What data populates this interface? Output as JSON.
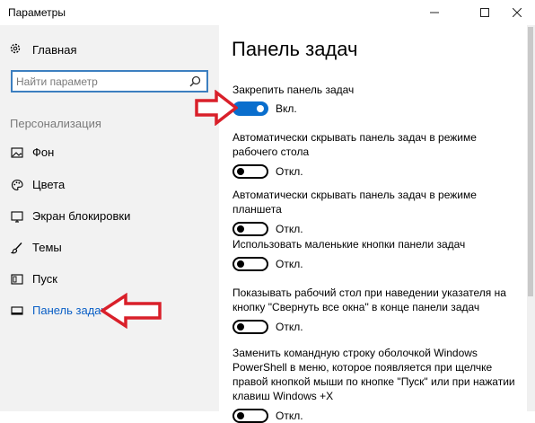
{
  "window": {
    "title": "Параметры",
    "minimize": "—",
    "maximize": "☐",
    "close": "✕"
  },
  "sidebar": {
    "home_label": "Главная",
    "search_placeholder": "Найти параметр",
    "section_header": "Персонализация",
    "items": [
      {
        "label": "Фон",
        "icon": "image-icon"
      },
      {
        "label": "Цвета",
        "icon": "palette-icon"
      },
      {
        "label": "Экран блокировки",
        "icon": "lock-screen-icon"
      },
      {
        "label": "Темы",
        "icon": "brush-icon"
      },
      {
        "label": "Пуск",
        "icon": "start-icon"
      },
      {
        "label": "Панель задач",
        "icon": "taskbar-icon",
        "selected": true
      }
    ]
  },
  "main": {
    "title": "Панель задач",
    "settings": [
      {
        "label": "Закрепить панель задач",
        "state": "Вкл.",
        "on": true
      },
      {
        "label": "Автоматически скрывать панель задач в режиме рабочего стола",
        "state": "Откл.",
        "on": false
      },
      {
        "label": "Автоматически скрывать панель задач в режиме планшета",
        "state": "Откл.",
        "on": false
      },
      {
        "label": "Использовать маленькие кнопки панели задач",
        "state": "Откл.",
        "on": false
      },
      {
        "label": "Показывать рабочий стол при наведении указателя на кнопку \"Свернуть все окна\" в конце панели задач",
        "state": "Откл.",
        "on": false
      },
      {
        "label": "Заменить командную строку оболочкой Windows PowerShell в меню, которое появляется при щелчке правой кнопкой мыши по кнопке \"Пуск\" или при нажатии клавиш Windows +X",
        "state": "Откл.",
        "on": false
      }
    ]
  },
  "colors": {
    "accent": "#0a6ecd",
    "annotation_arrow": "#d9202a",
    "sidebar_bg": "#f2f2f2"
  }
}
